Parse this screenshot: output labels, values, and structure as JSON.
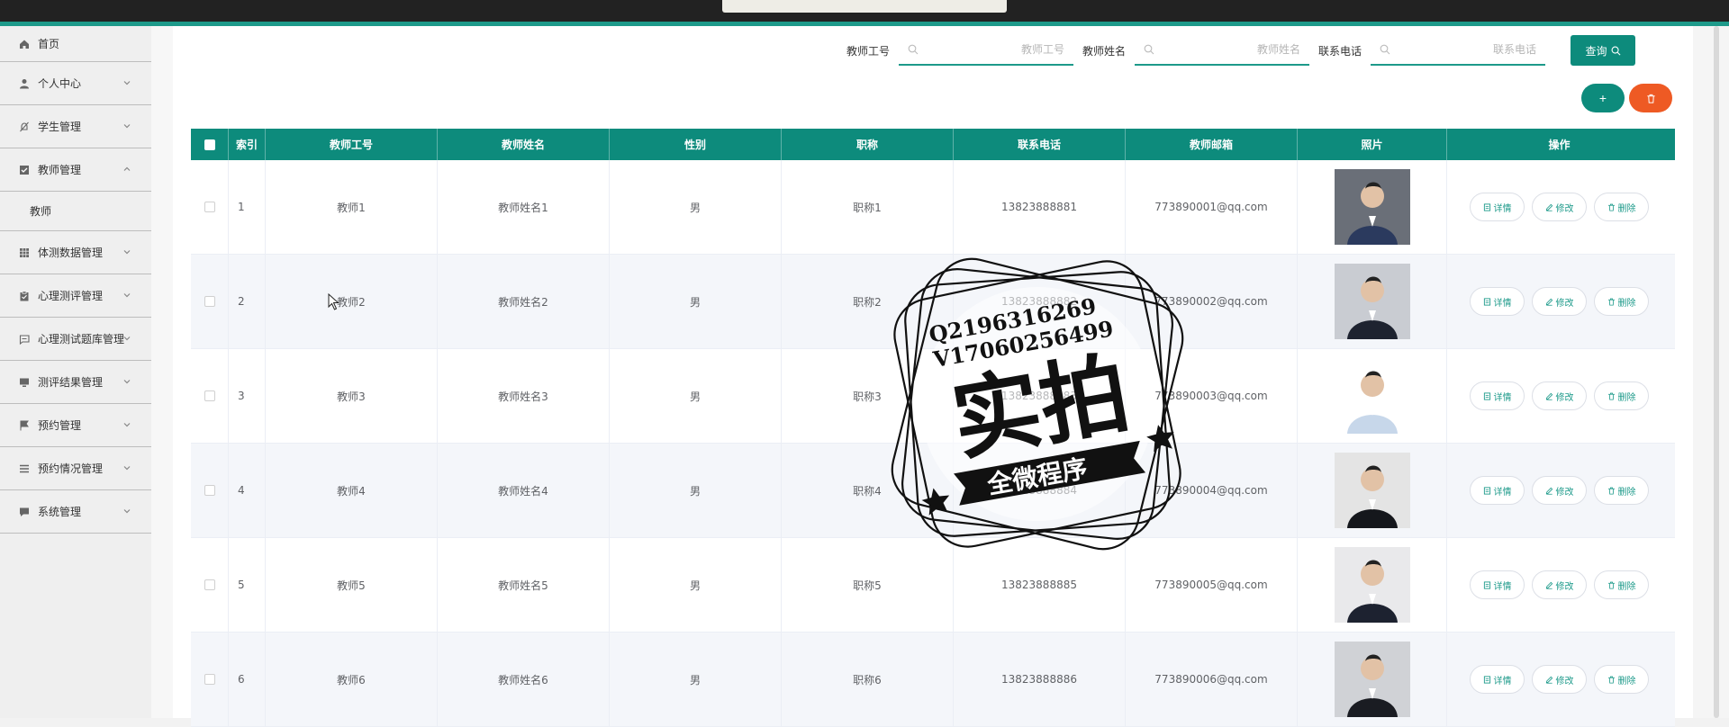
{
  "sidebar": {
    "items": [
      {
        "label": "首页",
        "icon": "home-icon"
      },
      {
        "label": "个人中心",
        "icon": "user-icon"
      },
      {
        "label": "学生管理",
        "icon": "bell-off-icon"
      },
      {
        "label": "教师管理",
        "icon": "checkbox-icon",
        "expanded": true
      },
      {
        "label": "教师",
        "icon": "",
        "sub": true
      },
      {
        "label": "体测数据管理",
        "icon": "grid-icon"
      },
      {
        "label": "心理测评管理",
        "icon": "clipboard-icon"
      },
      {
        "label": "心理测试题库管理",
        "icon": "message-icon"
      },
      {
        "label": "测评结果管理",
        "icon": "monitor-icon"
      },
      {
        "label": "预约管理",
        "icon": "flag-icon"
      },
      {
        "label": "预约情况管理",
        "icon": "list-icon"
      },
      {
        "label": "系统管理",
        "icon": "chat-icon"
      }
    ]
  },
  "search": {
    "fields": [
      {
        "label": "教师工号",
        "placeholder": "教师工号",
        "value": ""
      },
      {
        "label": "教师姓名",
        "placeholder": "教师姓名",
        "value": ""
      },
      {
        "label": "联系电话",
        "placeholder": "联系电话",
        "value": ""
      }
    ],
    "query_label": "查询"
  },
  "actions": {
    "add_label": "+"
  },
  "table": {
    "columns": [
      "索引",
      "教师工号",
      "教师姓名",
      "性别",
      "职称",
      "联系电话",
      "教师邮箱",
      "照片",
      "操作"
    ],
    "rows": [
      {
        "idx": "1",
        "gonghao": "教师1",
        "name": "教师姓名1",
        "gender": "男",
        "title": "职称1",
        "phone": "13823888881",
        "email": "773890001@qq.com"
      },
      {
        "idx": "2",
        "gonghao": "教师2",
        "name": "教师姓名2",
        "gender": "男",
        "title": "职称2",
        "phone": "13823888882",
        "email": "773890002@qq.com"
      },
      {
        "idx": "3",
        "gonghao": "教师3",
        "name": "教师姓名3",
        "gender": "男",
        "title": "职称3",
        "phone": "13823888883",
        "email": "773890003@qq.com"
      },
      {
        "idx": "4",
        "gonghao": "教师4",
        "name": "教师姓名4",
        "gender": "男",
        "title": "职称4",
        "phone": "13823888884",
        "email": "773890004@qq.com"
      },
      {
        "idx": "5",
        "gonghao": "教师5",
        "name": "教师姓名5",
        "gender": "男",
        "title": "职称5",
        "phone": "13823888885",
        "email": "773890005@qq.com"
      },
      {
        "idx": "6",
        "gonghao": "教师6",
        "name": "教师姓名6",
        "gender": "男",
        "title": "职称6",
        "phone": "13823888886",
        "email": "773890006@qq.com"
      }
    ],
    "ops": {
      "detail": "详情",
      "edit": "修改",
      "delete": "删除"
    }
  },
  "watermark": {
    "line1": "Q2196316269",
    "line2": "V17060256499",
    "main": "实拍",
    "banner": "全微程序"
  },
  "colors": {
    "primary": "#0d8b7c",
    "danger": "#ee5a24",
    "accent_line": "#1d9a8a"
  }
}
